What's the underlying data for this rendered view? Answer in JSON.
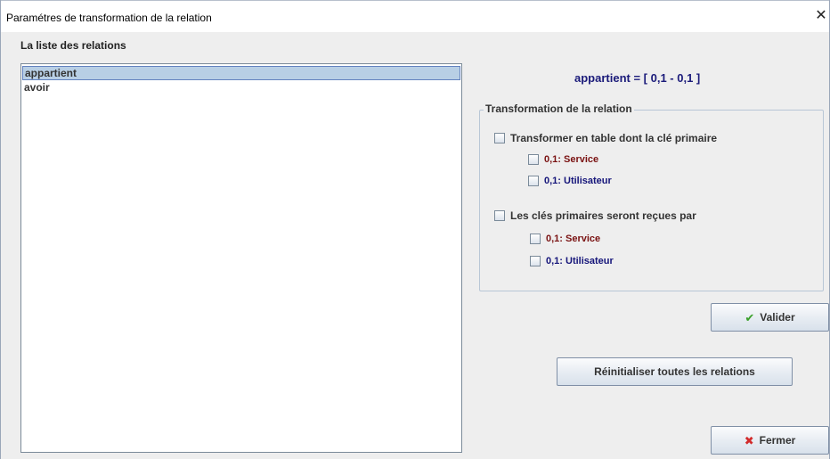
{
  "window": {
    "title": "Paramétres de transformation de la relation",
    "close_glyph": "✕"
  },
  "relations": {
    "label": "La liste des relations",
    "items": [
      {
        "label": "appartient",
        "selected": true
      },
      {
        "label": "avoir",
        "selected": false
      }
    ]
  },
  "summary": {
    "text": "appartient = [ 0,1 - 0,1 ]"
  },
  "transformation": {
    "title": "Transformation de la relation",
    "table_option": {
      "label": "Transformer en table  dont la clé primaire",
      "checked": false,
      "sub": [
        {
          "label": "0,1: Service",
          "checked": false
        },
        {
          "label": "0,1: Utilisateur",
          "checked": false
        }
      ]
    },
    "keys_option": {
      "label": "Les clés primaires seront reçues par",
      "checked": false,
      "sub": [
        {
          "label": "0,1: Service",
          "checked": false
        },
        {
          "label": "0,1: Utilisateur",
          "checked": false
        }
      ]
    }
  },
  "buttons": {
    "validate": {
      "label": "Valider",
      "icon": "check-icon"
    },
    "reset": {
      "label": "Réinitialiser toutes les relations"
    },
    "close": {
      "label": "Fermer",
      "icon": "x-icon"
    }
  },
  "colors": {
    "selection_bg": "#b8cfe5",
    "service_text": "#7a1212",
    "user_text": "#15157a",
    "summary_text": "#1b1b7a"
  }
}
